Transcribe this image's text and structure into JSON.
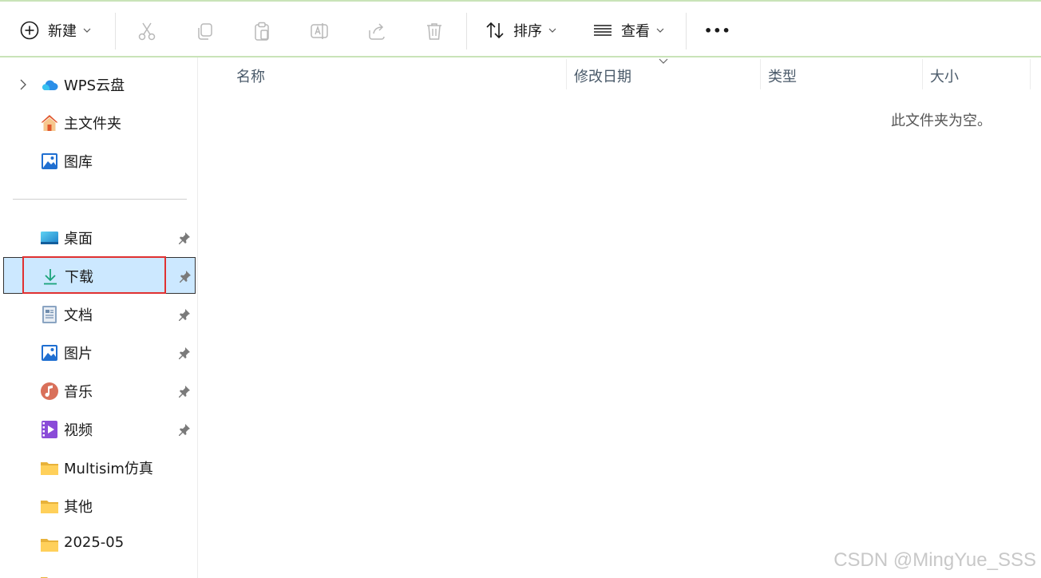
{
  "toolbar": {
    "new_label": "新建",
    "sort_label": "排序",
    "view_label": "查看",
    "more_label": "•••"
  },
  "sidebar": {
    "cloud": {
      "label": "WPS云盘"
    },
    "home": {
      "label": "主文件夹"
    },
    "gallery": {
      "label": "图库"
    },
    "items": [
      {
        "label": "桌面",
        "pinned": true
      },
      {
        "label": "下载",
        "pinned": true,
        "selected": true
      },
      {
        "label": "文档",
        "pinned": true
      },
      {
        "label": "图片",
        "pinned": true
      },
      {
        "label": "音乐",
        "pinned": true
      },
      {
        "label": "视频",
        "pinned": true
      },
      {
        "label": "Multisim仿真"
      },
      {
        "label": "其他"
      },
      {
        "label": "2025-05"
      }
    ]
  },
  "content": {
    "columns": [
      "名称",
      "修改日期",
      "类型",
      "大小"
    ],
    "empty_message": "此文件夹为空。"
  },
  "watermark": "CSDN @MingYue_SSS",
  "colors": {
    "selection_bg": "#cce8ff",
    "highlight_border": "#e03131",
    "download_icon": "#1aa37a"
  }
}
